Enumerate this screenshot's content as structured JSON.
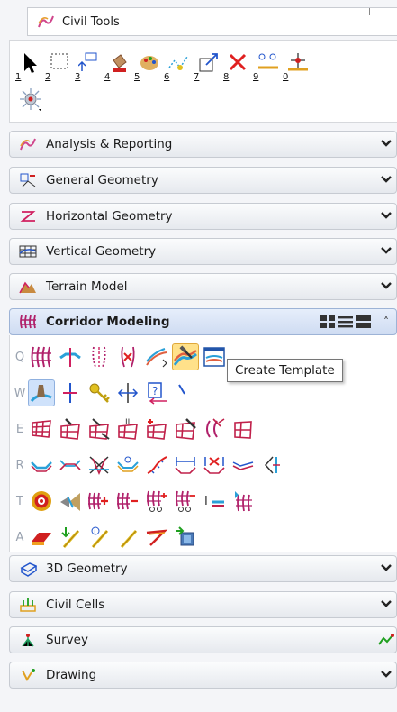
{
  "window": {
    "title": "Civil Tools"
  },
  "main_toolbar": {
    "tools": [
      {
        "num": "1",
        "icon": "select-arrow-icon"
      },
      {
        "num": "2",
        "icon": "selection-box-icon"
      },
      {
        "num": "3",
        "icon": "move-element-icon"
      },
      {
        "num": "4",
        "icon": "paint-bucket-icon"
      },
      {
        "num": "5",
        "icon": "palette-icon"
      },
      {
        "num": "6",
        "icon": "smart-line-icon"
      },
      {
        "num": "7",
        "icon": "scale-box-icon"
      },
      {
        "num": "8",
        "icon": "delete-x-icon"
      },
      {
        "num": "9",
        "icon": "measure-distance-icon"
      },
      {
        "num": "0",
        "icon": "ruler-point-icon"
      }
    ],
    "extra_tool": "accudraw-compass-icon"
  },
  "panels": [
    {
      "label": "Analysis & Reporting",
      "icon": "analysis-icon",
      "chevron": "❯"
    },
    {
      "label": "General Geometry",
      "icon": "general-geometry-icon",
      "chevron": "❯"
    },
    {
      "label": "Horizontal Geometry",
      "icon": "horizontal-geometry-icon",
      "chevron": "❯"
    },
    {
      "label": "Vertical Geometry",
      "icon": "vertical-geometry-icon",
      "chevron": "❯"
    },
    {
      "label": "Terrain Model",
      "icon": "terrain-model-icon",
      "chevron": "❯"
    }
  ],
  "corridor": {
    "label": "Corridor Modeling",
    "rows": [
      {
        "letter": "Q"
      },
      {
        "letter": "W"
      },
      {
        "letter": "E"
      },
      {
        "letter": "R"
      },
      {
        "letter": "T"
      },
      {
        "letter": "A"
      }
    ],
    "tooltip": "Create Template"
  },
  "lower_panels": [
    {
      "label": "3D Geometry",
      "icon": "3d-geometry-icon"
    },
    {
      "label": "Civil Cells",
      "icon": "civil-cells-icon"
    },
    {
      "label": "Survey",
      "icon": "survey-icon"
    },
    {
      "label": "Drawing",
      "icon": "drawing-icon"
    }
  ],
  "colors": {
    "accent": "#cfdcf2",
    "tooltip_border": "#767676",
    "highlight": "#ffe18a"
  }
}
